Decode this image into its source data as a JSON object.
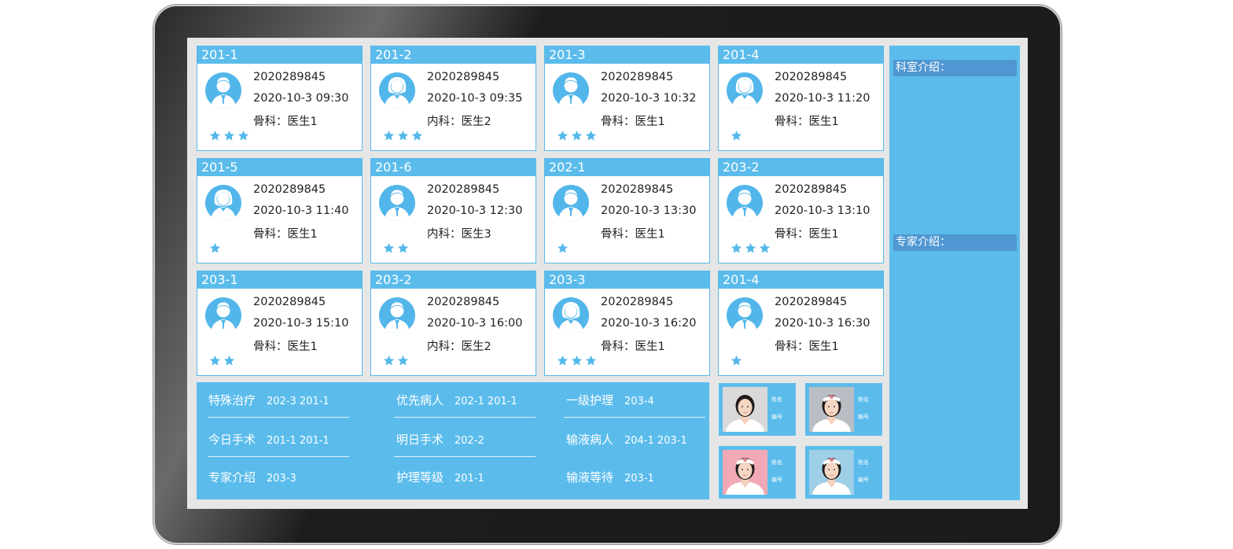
{
  "beds": [
    {
      "room": "201-1",
      "id": "2020289845",
      "time": "2020-10-3  09:30",
      "dept": "骨科：医生1",
      "stars": 3,
      "gender": "male"
    },
    {
      "room": "201-2",
      "id": "2020289845",
      "time": "2020-10-3  09:35",
      "dept": "内科：医生2",
      "stars": 3,
      "gender": "female"
    },
    {
      "room": "201-3",
      "id": "2020289845",
      "time": "2020-10-3  10:32",
      "dept": "骨科：医生1",
      "stars": 3,
      "gender": "male"
    },
    {
      "room": "201-4",
      "id": "2020289845",
      "time": "2020-10-3  11:20",
      "dept": "骨科：医生1",
      "stars": 1,
      "gender": "female"
    },
    {
      "room": "201-5",
      "id": "2020289845",
      "time": "2020-10-3  11:40",
      "dept": "骨科：医生1",
      "stars": 1,
      "gender": "female"
    },
    {
      "room": "201-6",
      "id": "2020289845",
      "time": "2020-10-3  12:30",
      "dept": "内科：医生3",
      "stars": 2,
      "gender": "male"
    },
    {
      "room": "202-1",
      "id": "2020289845",
      "time": "2020-10-3  13:30",
      "dept": "骨科：医生1",
      "stars": 1,
      "gender": "male"
    },
    {
      "room": "203-2",
      "id": "2020289845",
      "time": "2020-10-3  13:10",
      "dept": "骨科：医生1",
      "stars": 3,
      "gender": "male"
    },
    {
      "room": "203-1",
      "id": "2020289845",
      "time": "2020-10-3  15:10",
      "dept": "骨科：医生1",
      "stars": 2,
      "gender": "male"
    },
    {
      "room": "203-2",
      "id": "2020289845",
      "time": "2020-10-3  16:00",
      "dept": "内科：医生2",
      "stars": 2,
      "gender": "male"
    },
    {
      "room": "203-3",
      "id": "2020289845",
      "time": "2020-10-3  16:20",
      "dept": "骨科：医生1",
      "stars": 3,
      "gender": "female"
    },
    {
      "room": "201-4",
      "id": "2020289845",
      "time": "2020-10-3  16:30",
      "dept": "骨科：医生1",
      "stars": 1,
      "gender": "male"
    }
  ],
  "info_panel": [
    {
      "label": "特殊治疗",
      "value": "202-3  201-1"
    },
    {
      "label": "优先病人",
      "value": "202-1  201-1"
    },
    {
      "label": "一级护理",
      "value": "203-4"
    },
    {
      "label": "今日手术",
      "value": "201-1  201-1"
    },
    {
      "label": "明日手术",
      "value": "202-2"
    },
    {
      "label": "输液病人",
      "value": "204-1  203-1"
    },
    {
      "label": "专家介绍",
      "value": "203-3"
    },
    {
      "label": "护理等级",
      "value": "201-1"
    },
    {
      "label": "输液等待",
      "value": "203-1"
    }
  ],
  "staff": [
    {
      "name_label": "姓名",
      "id_label": "编号",
      "photo": "nurse-photo-plain",
      "photo_bg": "#d9d9d9"
    },
    {
      "name_label": "姓名",
      "id_label": "编号",
      "photo": "nurse-photo-cap",
      "photo_bg": "#b9bec4"
    },
    {
      "name_label": "姓名",
      "id_label": "编号",
      "photo": "nurse-photo-cap",
      "photo_bg": "#f2a9b6"
    },
    {
      "name_label": "姓名",
      "id_label": "编号",
      "photo": "nurse-photo-cap",
      "photo_bg": "#9fcfe6"
    }
  ],
  "sidebar": {
    "dept_intro": "科室介绍：",
    "expert_intro": "专家介绍："
  },
  "colors": {
    "accent": "#5bbcec",
    "sidebar_header": "#4f97d2",
    "star": "#55b8ea"
  }
}
